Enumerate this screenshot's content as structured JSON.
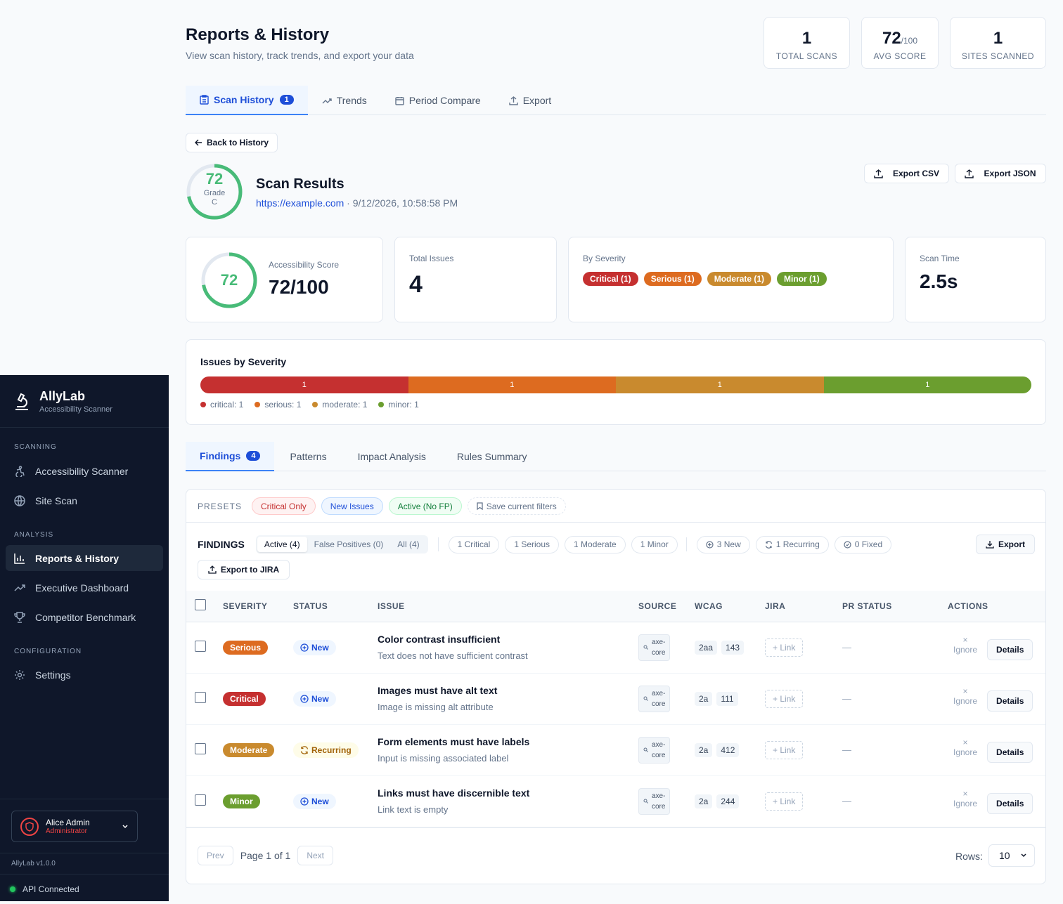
{
  "sidebar": {
    "brand": "AllyLab",
    "brand_sub": "Accessibility Scanner",
    "sections": [
      {
        "title": "SCANNING",
        "items": [
          "Accessibility Scanner",
          "Site Scan"
        ]
      },
      {
        "title": "ANALYSIS",
        "items": [
          "Reports & History",
          "Executive Dashboard",
          "Competitor Benchmark"
        ]
      },
      {
        "title": "CONFIGURATION",
        "items": [
          "Settings"
        ]
      }
    ],
    "user": {
      "name": "Alice Admin",
      "role": "Administrator"
    },
    "version": "AllyLab v1.0.0",
    "api_status": "API Connected"
  },
  "header": {
    "title": "Reports & History",
    "subtitle": "View scan history, track trends, and export your data"
  },
  "stats": [
    {
      "value": "1",
      "suffix": "",
      "label": "TOTAL SCANS"
    },
    {
      "value": "72",
      "suffix": "/100",
      "label": "AVG SCORE"
    },
    {
      "value": "1",
      "suffix": "",
      "label": "SITES SCANNED"
    }
  ],
  "tabs": [
    {
      "label": "Scan History",
      "badge": "1"
    },
    {
      "label": "Trends"
    },
    {
      "label": "Period Compare"
    },
    {
      "label": "Export"
    }
  ],
  "back_label": "Back to History",
  "scan": {
    "score": "72",
    "grade_label": "Grade",
    "grade": "C",
    "title": "Scan Results",
    "url": "https://example.com",
    "date": " · 9/12/2026, 10:58:58 PM",
    "export_csv": "Export CSV",
    "export_json": "Export JSON"
  },
  "cards": {
    "score_label": "Accessibility Score",
    "score_ring": "72",
    "score_value": "72/100",
    "issues_label": "Total Issues",
    "issues_value": "4",
    "severity_label": "By Severity",
    "severity_pills": [
      "Critical (1)",
      "Serious (1)",
      "Moderate (1)",
      "Minor (1)"
    ],
    "time_label": "Scan Time",
    "time_value": "2.5s"
  },
  "severity_chart": {
    "title": "Issues by Severity",
    "values": [
      "1",
      "1",
      "1",
      "1"
    ],
    "legend": [
      "critical: 1",
      "serious: 1",
      "moderate: 1",
      "minor: 1"
    ]
  },
  "colors": {
    "critical": "#c53030",
    "serious": "#dd6b20",
    "moderate": "#c98a2e",
    "minor": "#6b9e2f",
    "accent": "#1d4ed8",
    "ring": "#48bb78"
  },
  "subtabs": [
    {
      "label": "Findings",
      "badge": "4"
    },
    {
      "label": "Patterns"
    },
    {
      "label": "Impact Analysis"
    },
    {
      "label": "Rules Summary"
    }
  ],
  "presets": {
    "label": "PRESETS",
    "items": [
      "Critical Only",
      "New Issues",
      "Active (No FP)"
    ],
    "save": "Save current filters"
  },
  "findings": {
    "label": "FINDINGS",
    "segments": [
      "Active (4)",
      "False Positives (0)",
      "All (4)"
    ],
    "sev_chips": [
      "1 Critical",
      "1 Serious",
      "1 Moderate",
      "1 Minor"
    ],
    "status_chips": [
      "3 New",
      "1 Recurring",
      "0 Fixed"
    ],
    "export": "Export",
    "export_jira": "Export to JIRA"
  },
  "table": {
    "headers": [
      "SEVERITY",
      "STATUS",
      "ISSUE",
      "SOURCE",
      "WCAG",
      "JIRA",
      "PR STATUS",
      "ACTIONS"
    ],
    "rows": [
      {
        "severity": "Serious",
        "sev_key": "serious",
        "status": "New",
        "issue": "Color contrast insufficient",
        "desc": "Text does not have sufficient contrast",
        "source1": "axe-",
        "source2": "core",
        "wcag": "2aa",
        "wcag_id": "143",
        "jira": "+ Link",
        "pr": "—",
        "ignore": "Ignore",
        "details": "Details"
      },
      {
        "severity": "Critical",
        "sev_key": "critical",
        "status": "New",
        "issue": "Images must have alt text",
        "desc": "Image is missing alt attribute",
        "source1": "axe-",
        "source2": "core",
        "wcag": "2a",
        "wcag_id": "111",
        "jira": "+ Link",
        "pr": "—",
        "ignore": "Ignore",
        "details": "Details"
      },
      {
        "severity": "Moderate",
        "sev_key": "moderate",
        "status": "Recurring",
        "issue": "Form elements must have labels",
        "desc": "Input is missing associated label",
        "source1": "axe-",
        "source2": "core",
        "wcag": "2a",
        "wcag_id": "412",
        "jira": "+ Link",
        "pr": "—",
        "ignore": "Ignore",
        "details": "Details"
      },
      {
        "severity": "Minor",
        "sev_key": "minor",
        "status": "New",
        "issue": "Links must have discernible text",
        "desc": "Link text is empty",
        "source1": "axe-",
        "source2": "core",
        "wcag": "2a",
        "wcag_id": "244",
        "jira": "+ Link",
        "pr": "—",
        "ignore": "Ignore",
        "details": "Details"
      }
    ]
  },
  "pagination": {
    "prev": "Prev",
    "page": "Page 1 of 1",
    "next": "Next",
    "rows_label": "Rows:",
    "rows_value": "10"
  }
}
